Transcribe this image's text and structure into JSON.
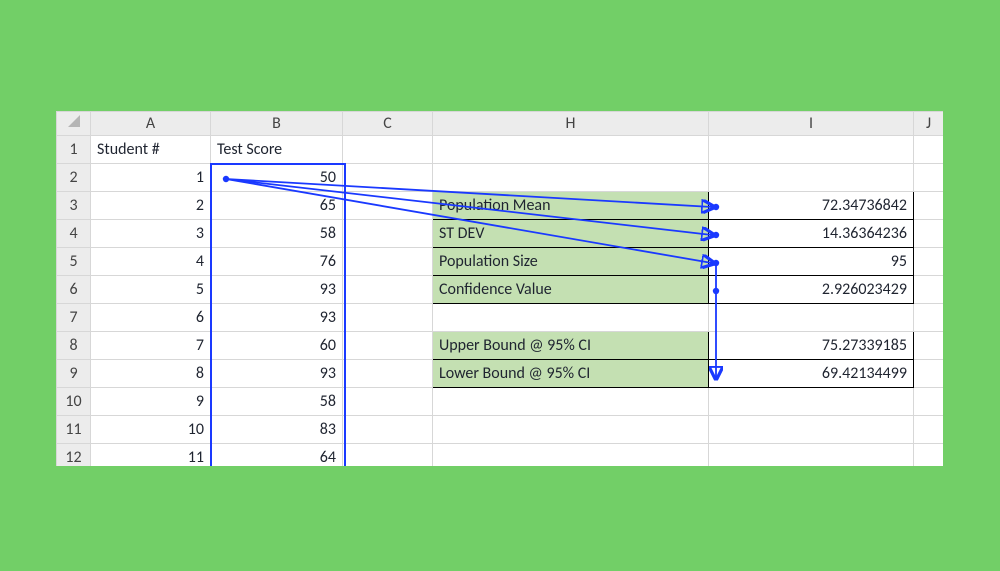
{
  "columns": {
    "row": "",
    "A": "A",
    "B": "B",
    "C": "C",
    "H": "H",
    "I": "I",
    "J": "J"
  },
  "headers": {
    "A": "Student #",
    "B": "Test Score"
  },
  "students": [
    {
      "n": "1",
      "score": "50"
    },
    {
      "n": "2",
      "score": "65"
    },
    {
      "n": "3",
      "score": "58"
    },
    {
      "n": "4",
      "score": "76"
    },
    {
      "n": "5",
      "score": "93"
    },
    {
      "n": "6",
      "score": "93"
    },
    {
      "n": "7",
      "score": "60"
    },
    {
      "n": "8",
      "score": "93"
    },
    {
      "n": "9",
      "score": "58"
    },
    {
      "n": "10",
      "score": "83"
    },
    {
      "n": "11",
      "score": "64"
    }
  ],
  "stats": {
    "population_mean": {
      "label": "Population Mean",
      "value": "72.34736842"
    },
    "st_dev": {
      "label": "ST DEV",
      "value": "14.36364236"
    },
    "population_size": {
      "label": "Population Size",
      "value": "95"
    },
    "confidence_value": {
      "label": "Confidence Value",
      "value": "2.926023429"
    },
    "upper_bound": {
      "label": "Upper Bound @ 95% CI",
      "value": "75.27339185"
    },
    "lower_bound": {
      "label": "Lower Bound @ 95% CI",
      "value": "69.42134499"
    }
  },
  "rownums": [
    "1",
    "2",
    "3",
    "4",
    "5",
    "6",
    "7",
    "8",
    "9",
    "10",
    "11",
    "12"
  ],
  "colors": {
    "accent": "#1a39ff",
    "shade": "#c4e0b2"
  }
}
